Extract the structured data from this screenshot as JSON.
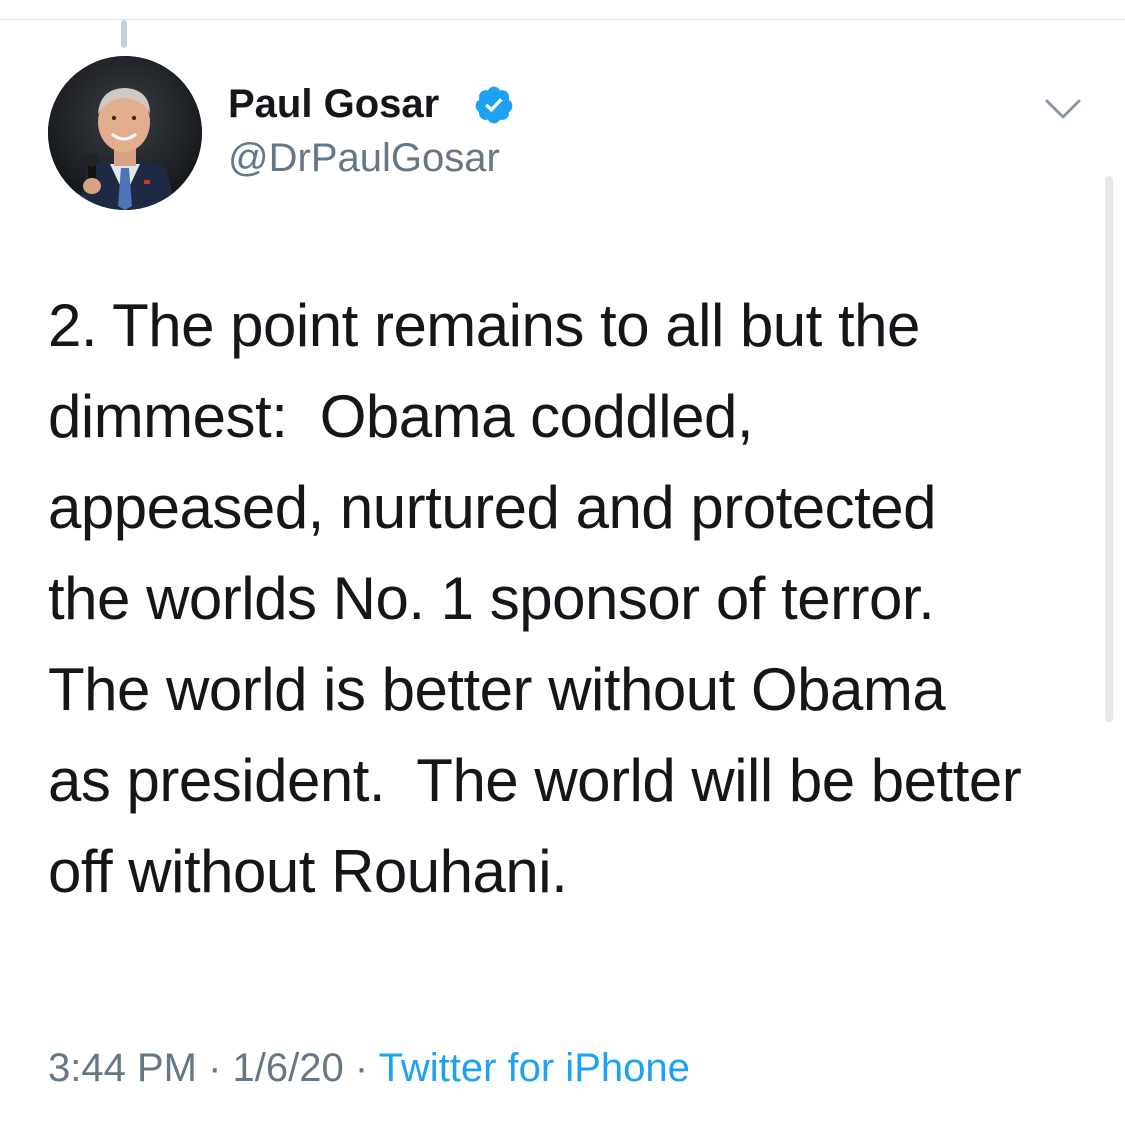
{
  "tweet": {
    "author": {
      "display_name": "Paul Gosar",
      "handle": "@DrPaulGosar",
      "verified": true,
      "verified_icon": "verified-badge-icon",
      "avatar_icon": "profile-photo"
    },
    "text": "2. The point remains to all but the\ndimmest:  Obama coddled,\nappeased, nurtured and protected\nthe worlds No. 1 sponsor of terror.\nThe world is better without Obama\nas president.  The world will be better\noff without Rouhani.",
    "time": "3:44 PM",
    "separator": "·",
    "date": "1/6/20",
    "source": "Twitter for iPhone",
    "menu_icon": "chevron-down-icon"
  },
  "colors": {
    "text_primary": "#14171a",
    "text_secondary": "#657786",
    "accent": "#1da1f2",
    "divider": "#e1e4e6"
  }
}
